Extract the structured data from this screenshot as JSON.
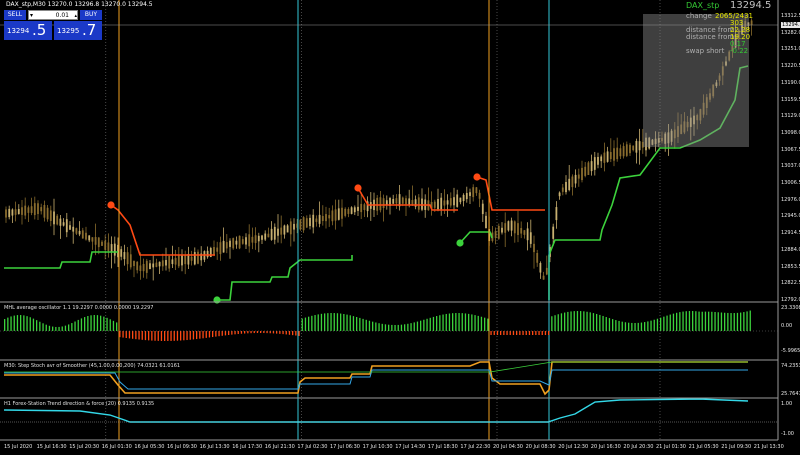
{
  "symbol_header": "DAX_stp,M30  13270.0 13296.8 13270.0 13294.5",
  "trade_panel": {
    "sell_label": "SELL",
    "buy_label": "BUY",
    "lot": "0.01",
    "bid_small": "13294",
    "bid_big": ".5",
    "ask_small": "13295",
    "ask_big": ".7"
  },
  "info_panel": {
    "title": "DAX_stp",
    "price": "13294.5",
    "lines": [
      {
        "label": "change",
        "value": "2065/2431",
        "color": "#e6e600"
      },
      {
        "label": "",
        "value": "303",
        "color": "#e6e600"
      },
      {
        "label": "distance from",
        "value": "22.28",
        "color": "#e6e600"
      },
      {
        "label": "distance from",
        "value": "19.20",
        "color": "#e6e600"
      },
      {
        "label": "",
        "value": "0.17",
        "color": "#34c934"
      },
      {
        "label": "swap short",
        "value": "-0.22",
        "color": "#34c934"
      }
    ]
  },
  "price_axis": [
    "13312.5",
    "13282.0",
    "13251.0",
    "13220.5",
    "13190.0",
    "13159.5",
    "13129.0",
    "13098.0",
    "13067.5",
    "13037.0",
    "13006.5",
    "12976.0",
    "12945.0",
    "12914.5",
    "12884.0",
    "12853.5",
    "12822.5",
    "12792.0"
  ],
  "current_price_label": "13294.5",
  "time_axis": [
    "15 Jul 2020",
    "15 Jul 16:30",
    "15 Jul 20:30",
    "16 Jul 01:30",
    "16 Jul 05:30",
    "16 Jul 09:30",
    "16 Jul 13:30",
    "16 Jul 17:30",
    "16 Jul 21:30",
    "17 Jul 02:30",
    "17 Jul 06:30",
    "17 Jul 10:30",
    "17 Jul 14:30",
    "17 Jul 18:30",
    "17 Jul 22:30",
    "20 Jul 04:30",
    "20 Jul 08:30",
    "20 Jul 12:30",
    "20 Jul 16:30",
    "20 Jul 20:30",
    "21 Jul 01:30",
    "21 Jul 05:30",
    "21 Jul 09:30",
    "21 Jul 13:30"
  ],
  "sub_panels": [
    {
      "title": "MHL average oscillator 1.1 19.2297 0.0000 0.0000 19.2297",
      "axis_top": "23.3308",
      "axis_mid": "0.00",
      "axis_bottom": "-5.9965"
    },
    {
      "title": "M30: Step Stoch avr of Smoother (45,1.00,0.00,200) 74.0321 61.0161",
      "axis_top": "74.2353",
      "axis_bottom": "25.7647"
    },
    {
      "title": "H1 Forex-Station Trend direction & force (20) 0.9135 0.9135",
      "axis_top": "1.00",
      "axis_bottom": "-1.00"
    }
  ],
  "colors": {
    "background": "#000000",
    "bull_candle": "#c8b070",
    "bear_candle": "#8a6d2e",
    "stop_green": "#3cd23c",
    "stop_red": "#ff4a14",
    "vline_orange": "#f0a020",
    "vline_cyan": "#33c7d8",
    "stoch_orange": "#f0a020",
    "stoch_blue": "#33a7e8",
    "trend_cyan": "#33d8e8",
    "hist_green": "#3cd23c",
    "hist_red": "#ff4a14"
  }
}
